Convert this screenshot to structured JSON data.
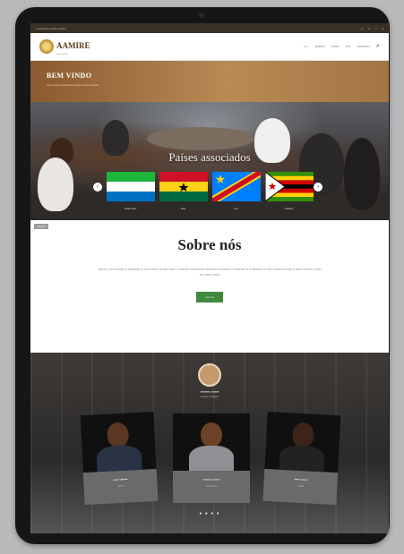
{
  "header": {
    "logo_text": "AAMIRE",
    "nav": [
      "",
      "",
      "",
      "",
      ""
    ]
  },
  "welcome": {
    "title": "BEM VINDO",
    "subtitle": ""
  },
  "countries": {
    "title": "Países associados",
    "flags": [
      {
        "name": "Sierra Leone",
        "caption": ""
      },
      {
        "name": "Ghana",
        "caption": ""
      },
      {
        "name": "DR Congo",
        "caption": ""
      },
      {
        "name": "Zimbabwe",
        "caption": ""
      }
    ]
  },
  "about": {
    "title": "Sobre nós",
    "text": "",
    "button": ""
  },
  "team": {
    "leader_name": "",
    "leader_role": "",
    "members": [
      {
        "name": "",
        "role": ""
      },
      {
        "name": "",
        "role": ""
      },
      {
        "name": "",
        "role": ""
      }
    ],
    "dots": "● ● ● ●"
  },
  "colors": {
    "accent_gold": "#c59a3c",
    "brown": "#8b5a30",
    "button_green": "#3f8a3d"
  }
}
